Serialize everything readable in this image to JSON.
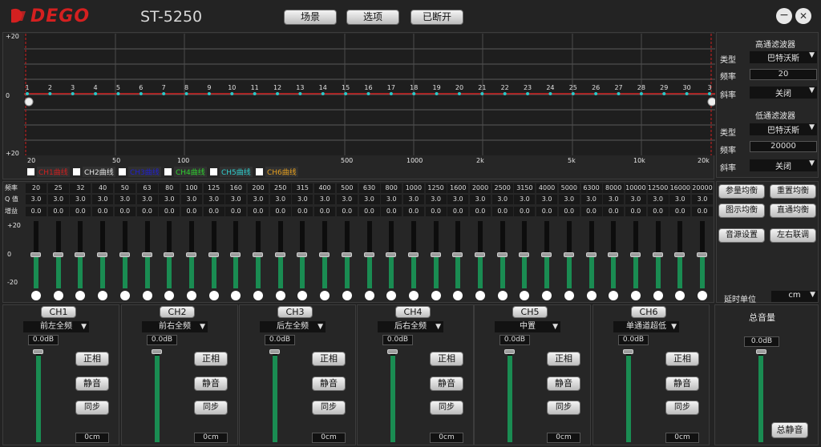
{
  "header": {
    "logo": "DEGO",
    "model": "ST-5250",
    "buttons": [
      "场景",
      "选项",
      "已断开"
    ]
  },
  "window": {
    "minimize": "−",
    "close": "✕"
  },
  "graph": {
    "y_labels": [
      "+20",
      "0",
      "+20"
    ],
    "x_labels": [
      "20",
      "50",
      "100",
      "500",
      "1000",
      "2k",
      "5k",
      "10k",
      "20k"
    ],
    "points": [
      "1",
      "2",
      "3",
      "4",
      "5",
      "6",
      "7",
      "8",
      "9",
      "10",
      "11",
      "12",
      "13",
      "14",
      "15",
      "16",
      "17",
      "18",
      "19",
      "20",
      "21",
      "22",
      "23",
      "24",
      "25",
      "26",
      "27",
      "28",
      "29",
      "30",
      "3"
    ],
    "curves": [
      {
        "label": "CH1曲线",
        "color": "#d02020"
      },
      {
        "label": "CH2曲线",
        "color": "#e6e6e6"
      },
      {
        "label": "CH3曲线",
        "color": "#2020d0"
      },
      {
        "label": "CH4曲线",
        "color": "#30d030"
      },
      {
        "label": "CH5曲线",
        "color": "#30d0d0"
      },
      {
        "label": "CH6曲线",
        "color": "#e6a020"
      }
    ]
  },
  "filters": {
    "hp_title": "高通滤波器",
    "lp_title": "低通滤波器",
    "type_label": "类型",
    "freq_label": "频率",
    "slope_label": "斜率",
    "hp_type": "巴特沃斯",
    "hp_freq": "20",
    "hp_slope": "关闭",
    "lp_type": "巴特沃斯",
    "lp_freq": "20000",
    "lp_slope": "关闭"
  },
  "eq": {
    "row_labels": [
      "频率",
      "Q 值",
      "增益"
    ],
    "scale": [
      "+20",
      "0",
      "-20"
    ],
    "freqs": [
      "20",
      "25",
      "32",
      "40",
      "50",
      "63",
      "80",
      "100",
      "125",
      "160",
      "200",
      "250",
      "315",
      "400",
      "500",
      "630",
      "800",
      "1000",
      "1250",
      "1600",
      "2000",
      "2500",
      "3150",
      "4000",
      "5000",
      "6300",
      "8000",
      "10000",
      "12500",
      "16000",
      "20000"
    ],
    "q": "3.0",
    "gain": "0.0"
  },
  "eq_buttons": [
    "参量均衡",
    "重置均衡",
    "图示均衡",
    "直通均衡",
    "音源设置",
    "左右联调"
  ],
  "delay": {
    "label": "延时单位",
    "unit": "cm"
  },
  "channels": [
    {
      "name": "CH1",
      "source": "前左全频",
      "gain": "0.0dB",
      "delay": "0cm"
    },
    {
      "name": "CH2",
      "source": "前右全频",
      "gain": "0.0dB",
      "delay": "0cm"
    },
    {
      "name": "CH3",
      "source": "后左全频",
      "gain": "0.0dB",
      "delay": "0cm"
    },
    {
      "name": "CH4",
      "source": "后右全频",
      "gain": "0.0dB",
      "delay": "0cm"
    },
    {
      "name": "CH5",
      "source": "中置",
      "gain": "0.0dB",
      "delay": "0cm"
    },
    {
      "name": "CH6",
      "source": "单通道超低",
      "gain": "0.0dB",
      "delay": "0cm"
    }
  ],
  "channel_buttons": {
    "phase": "正相",
    "mute": "静音",
    "sync": "同步"
  },
  "master": {
    "title": "总音量",
    "gain": "0.0dB",
    "mute": "总静音"
  }
}
